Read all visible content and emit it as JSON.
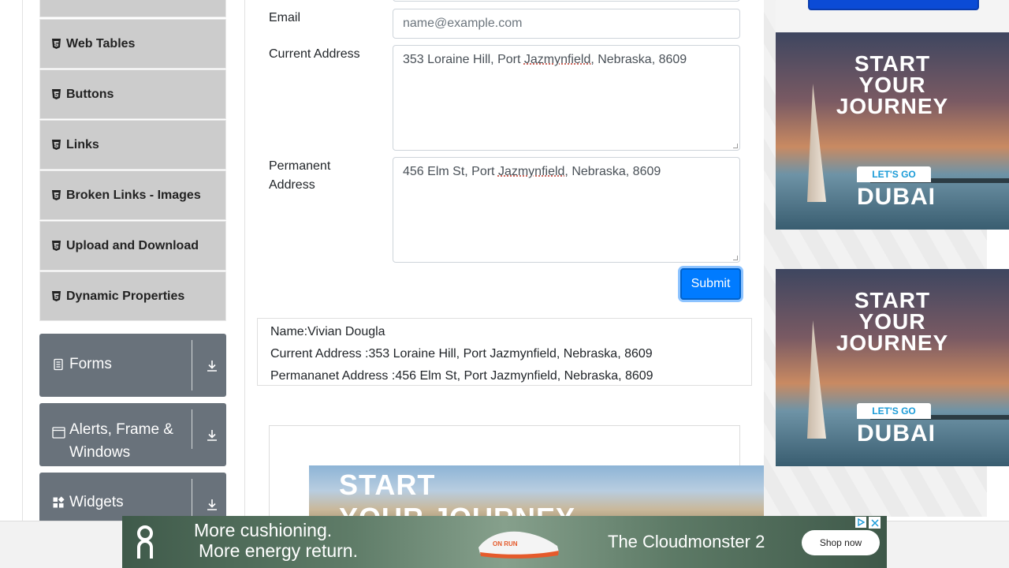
{
  "sidebar": {
    "items": [
      {
        "label": "Web Tables"
      },
      {
        "label": "Buttons"
      },
      {
        "label": "Links"
      },
      {
        "label": "Broken Links - Images"
      },
      {
        "label": "Upload and Download"
      },
      {
        "label": "Dynamic Properties"
      }
    ],
    "groups": [
      {
        "label": "Forms",
        "icon": "document-icon"
      },
      {
        "label": "Alerts, Frame &",
        "label2": "Windows",
        "icon": "window-icon"
      },
      {
        "label": "Widgets",
        "icon": "widgets-icon"
      }
    ]
  },
  "form": {
    "email": {
      "label": "Email",
      "placeholder": "name@example.com"
    },
    "current_address": {
      "label": "Current Address",
      "value_pre": "353 Loraine Hill, Port ",
      "value_mark": "Jazmynfield,",
      "value_post": " Nebraska, 8609"
    },
    "permanent_address": {
      "label_line1": "Permanent",
      "label_line2": "Address",
      "value_pre": "456 Elm St, Port ",
      "value_mark": "Jazmynfield",
      "value_post": ", Nebraska, 8609"
    },
    "submit_label": "Submit"
  },
  "output": {
    "name": "Name:Vivian Dougla",
    "current_address": "Current Address :353 Loraine Hill, Port Jazmynfield, Nebraska, 8609",
    "permanent_address": "Permananet Address :456 Elm St, Port Jazmynfield, Nebraska, 8609"
  },
  "ads": {
    "side": {
      "line1": "START",
      "line2": "YOUR",
      "line3": "JOURNEY",
      "tag": "LET'S GO",
      "brand": "DUBAI"
    },
    "middle": {
      "line1": "START",
      "line2": "YOUR JOURNEY"
    },
    "bottom": {
      "line1": "More cushioning.",
      "line2": "More energy return.",
      "product": "The Cloudmonster 2",
      "cta": "Shop now",
      "shoe_label": "ON RUN"
    }
  },
  "colors": {
    "primary": "#007bff",
    "group_bg": "#69727b",
    "item_bg": "#cccccc"
  }
}
